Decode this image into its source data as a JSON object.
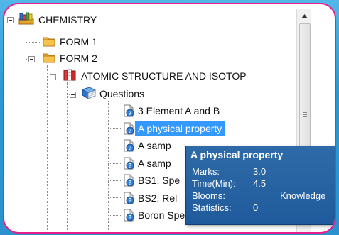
{
  "tree": {
    "root": {
      "label": "CHEMISTRY"
    },
    "forms": [
      {
        "label": "FORM 1"
      },
      {
        "label": "FORM 2"
      }
    ],
    "topic": {
      "label": "ATOMIC STRUCTURE AND ISOTOP"
    },
    "questions_folder": {
      "label": "Questions"
    },
    "questions": [
      {
        "label": "3 Element A and B",
        "selected": false
      },
      {
        "label": "A physical property",
        "selected": true
      },
      {
        "label": "A samp",
        "selected": false
      },
      {
        "label": "A samp",
        "selected": false
      },
      {
        "label": "BS1. Spe",
        "selected": false
      },
      {
        "label": "BS2. Rel",
        "selected": false
      },
      {
        "label": "Boron Spectrum",
        "selected": false
      }
    ]
  },
  "tooltip": {
    "title": "A physical property",
    "rows": [
      {
        "key": "Marks:",
        "value": "3.0"
      },
      {
        "key": "Time(Min):",
        "value": "4.5"
      },
      {
        "key": "Blooms:",
        "value": "Knowledge"
      },
      {
        "key": "Statistics:",
        "value": "0"
      }
    ]
  },
  "colors": {
    "frame_border": "#e61e8c",
    "selection": "#3399ff",
    "tooltip_bg": "#2463a3",
    "background": "#2a98d4"
  }
}
